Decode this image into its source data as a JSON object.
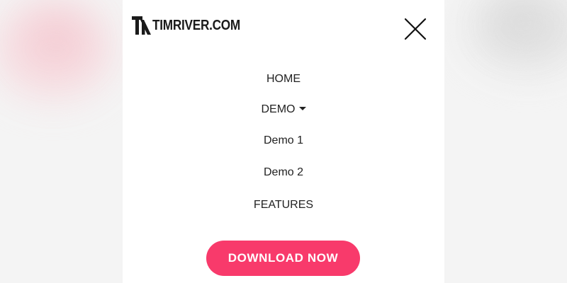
{
  "logo": {
    "text": "TIMRIVER.COM",
    "mark_icon": "tr-monogram-logo-icon",
    "text_color": "#1b1b1b"
  },
  "header": {
    "close_icon": "close-icon"
  },
  "menu": {
    "items": [
      {
        "label": "HOME"
      },
      {
        "label": "DEMO",
        "has_dropdown": true,
        "dropdown_icon": "caret-down-icon"
      },
      {
        "label": "Demo 1"
      },
      {
        "label": "Demo 2"
      },
      {
        "label": "FEATURES"
      }
    ]
  },
  "cta": {
    "label": "DOWNLOAD NOW",
    "background_color": "#f83a6b",
    "text_color": "#ffffff"
  }
}
